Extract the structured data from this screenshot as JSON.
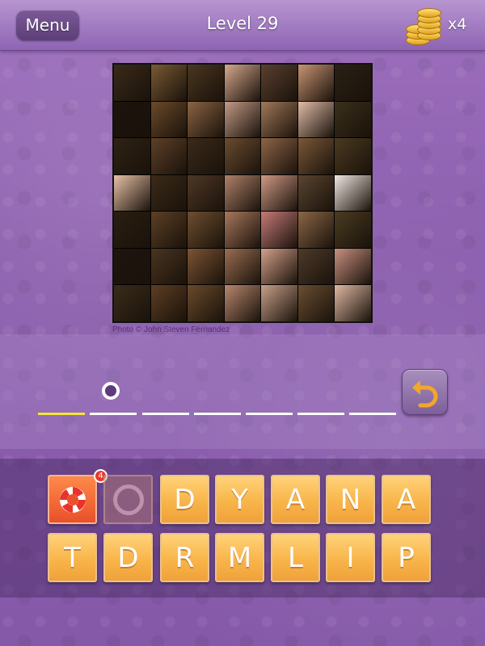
{
  "header": {
    "menu_label": "Menu",
    "level_title": "Level 29",
    "coin_count": "x4"
  },
  "puzzle": {
    "grid_rows": 7,
    "grid_cols": 7,
    "credit": "Photo © John Steven Fernandez",
    "tile_colors": [
      "#3a2a1a",
      "#7a5a34",
      "#4a3620",
      "#d6a88e",
      "#5a4030",
      "#c89474",
      "#2a2015",
      "#1c140c",
      "#6b4a2a",
      "#8a6444",
      "#c29a86",
      "#a0785a",
      "#e0bca8",
      "#3a301c",
      "#2e2214",
      "#5e4028",
      "#3a2a1a",
      "#6a4c30",
      "#8e6448",
      "#7a5838",
      "#4a3a20",
      "#e8c2a8",
      "#3c2a18",
      "#4e3826",
      "#b0826a",
      "#d09a86",
      "#5a4430",
      "#f2e8e4",
      "#2a1e10",
      "#5c4026",
      "#6e4e30",
      "#a8785c",
      "#c67a78",
      "#8a6646",
      "#4a3c22",
      "#1e160e",
      "#4a3420",
      "#7c5434",
      "#9a6e52",
      "#d4a08a",
      "#4e3a2a",
      "#c89080",
      "#3a2c1a",
      "#5e3e24",
      "#6a4a2c",
      "#b8876e",
      "#c8a08a",
      "#6a4e32",
      "#e0b8a4"
    ]
  },
  "answer": {
    "slot_count": 7,
    "active_slot": 0,
    "typed_letter_symbol": "O"
  },
  "hint_badge_count": "4",
  "letters": [
    {
      "char": "O",
      "used": true
    },
    {
      "char": "D",
      "used": false
    },
    {
      "char": "Y",
      "used": false
    },
    {
      "char": "A",
      "used": false
    },
    {
      "char": "N",
      "used": false
    },
    {
      "char": "A",
      "used": false
    },
    {
      "char": "T",
      "used": false
    },
    {
      "char": "D",
      "used": false
    },
    {
      "char": "R",
      "used": false
    },
    {
      "char": "M",
      "used": false
    },
    {
      "char": "L",
      "used": false
    },
    {
      "char": "I",
      "used": false
    },
    {
      "char": "P",
      "used": false
    }
  ],
  "icons": {
    "menu": "menu-button",
    "coins": "coin-stack-icon",
    "undo": "undo-arrow-icon",
    "help": "lifebuoy-icon"
  }
}
